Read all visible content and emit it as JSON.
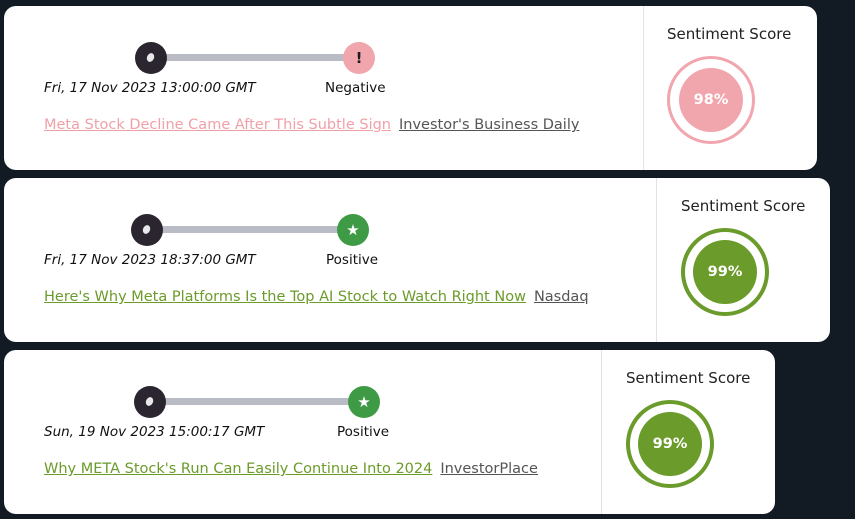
{
  "articles": [
    {
      "date": "Fri, 17 Nov 2023 13:00:00 GMT",
      "sentiment": "Negative",
      "end_icon": "exclamation-icon",
      "end_glyph": "!",
      "headline": "Meta Stock Decline Came After This Subtle Sign",
      "source": "Investor's Business Daily",
      "score_title": "Sentiment Score",
      "score": "98%"
    },
    {
      "date": "Fri, 17 Nov 2023 18:37:00 GMT",
      "sentiment": "Positive",
      "end_icon": "star-icon",
      "end_glyph": "★",
      "headline": "Here's Why Meta Platforms Is the Top AI Stock to Watch Right Now",
      "source": "Nasdaq",
      "score_title": "Sentiment Score",
      "score": "99%"
    },
    {
      "date": "Sun, 19 Nov 2023 15:00:17 GMT",
      "sentiment": "Positive",
      "end_icon": "star-icon",
      "end_glyph": "★",
      "headline": "Why META Stock's Run Can Easily Continue Into 2024",
      "source": "InvestorPlace",
      "score_title": "Sentiment Score",
      "score": "99%"
    }
  ],
  "colors": {
    "negative": "#f0a6ac",
    "positive": "#6b9b2a",
    "positive_icon": "#3f9a45",
    "background": "#121a24"
  }
}
